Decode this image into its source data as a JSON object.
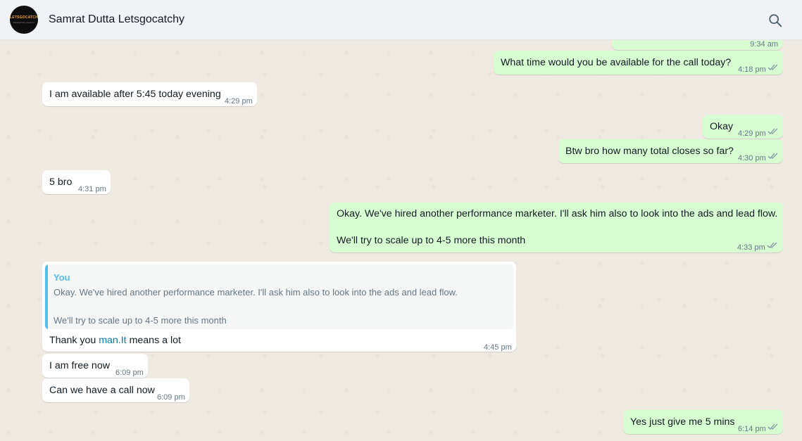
{
  "header": {
    "title": "Samrat Dutta Letsgocatchy",
    "avatar_text": "LETSGOCATCHY",
    "avatar_sub": "MARKETING AGENCY",
    "search_icon": "search-icon"
  },
  "messages": [
    {
      "dir": "out",
      "text": "",
      "time": "9:34 am",
      "ticks": false
    },
    {
      "dir": "out",
      "text": "What time would you be available for the call today?",
      "time": "4:18 pm",
      "ticks": true
    },
    {
      "dir": "in",
      "text": "I am available after 5:45 today evening",
      "time": "4:29 pm"
    },
    {
      "dir": "out",
      "text": "Okay",
      "time": "4:29 pm",
      "ticks": true
    },
    {
      "dir": "out",
      "text": "Btw bro how many total closes so far?",
      "time": "4:30 pm",
      "ticks": true
    },
    {
      "dir": "in",
      "text": "5 bro",
      "time": "4:31 pm"
    },
    {
      "dir": "out",
      "line1": "Okay. We've hired another performance marketer. I'll ask him also to look into the ads and lead flow.",
      "line2": "We'll try to scale up to 4-5 more this month",
      "time": "4:33 pm",
      "ticks": true
    },
    {
      "dir": "in",
      "quote": {
        "author": "You",
        "line1": "Okay. We've hired another performance marketer. I'll ask him also to look into the ads and lead flow.",
        "line2": "We'll try to scale up to 4-5 more this month"
      },
      "text_before": "Thank you ",
      "link": "man.It",
      "text_after": " means a lot",
      "time": "4:45 pm"
    },
    {
      "dir": "in",
      "text": "I am free now",
      "time": "6:09 pm"
    },
    {
      "dir": "in",
      "text": "Can we have a call now",
      "time": "6:09 pm"
    },
    {
      "dir": "out",
      "text": "Yes just give me 5 mins",
      "time": "6:14 pm",
      "ticks": true
    }
  ],
  "colors": {
    "outgoing": "#d9fdd3",
    "incoming": "#ffffff",
    "tick": "#8696a0",
    "link": "#027eb5",
    "quote_bar": "#53bdeb"
  }
}
